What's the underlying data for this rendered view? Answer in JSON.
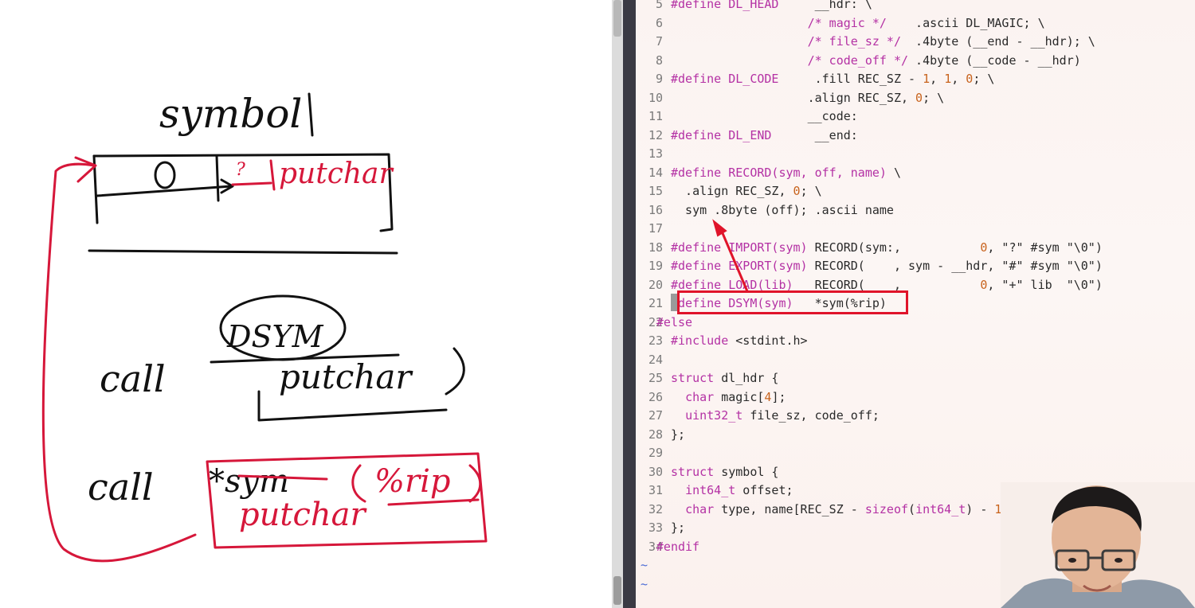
{
  "colors": {
    "macro": "#b431a4",
    "number": "#c8631d",
    "annotation_red": "#e0142a",
    "ink_red": "#d6173a",
    "ink_black": "#111111",
    "editor_bg": "#fbf3f1"
  },
  "whiteboard": {
    "label_symbol": "symbol",
    "cell_zero": "0",
    "cell_question": "?",
    "cell_putchar": "putchar",
    "call1_label": "call",
    "call1_circled": "DSYM",
    "call1_name": "putchar",
    "call2_label": "call",
    "call2_struck": "*sym",
    "call2_rip": "%rip",
    "call2_replacement": "putchar"
  },
  "editor": {
    "lines": [
      {
        "n": "5",
        "parts": [
          [
            "k-macro",
            "#define DL_HEAD"
          ],
          [
            "k-str",
            "     __hdr: \\"
          ]
        ]
      },
      {
        "n": "6",
        "parts": [
          [
            "k-str",
            "                   "
          ],
          [
            "k-macro",
            "/* magic */"
          ],
          [
            "k-str",
            "    .ascii DL_MAGIC; \\"
          ]
        ]
      },
      {
        "n": "7",
        "parts": [
          [
            "k-str",
            "                   "
          ],
          [
            "k-macro",
            "/* file_sz */"
          ],
          [
            "k-str",
            "  .4byte (__end - __hdr); \\"
          ]
        ]
      },
      {
        "n": "8",
        "parts": [
          [
            "k-str",
            "                   "
          ],
          [
            "k-macro",
            "/* code_off */"
          ],
          [
            "k-str",
            " .4byte (__code - __hdr)"
          ]
        ]
      },
      {
        "n": "9",
        "parts": [
          [
            "k-macro",
            "#define DL_CODE"
          ],
          [
            "k-str",
            "     .fill REC_SZ - "
          ],
          [
            "k-num",
            "1"
          ],
          [
            "k-str",
            ", "
          ],
          [
            "k-num",
            "1"
          ],
          [
            "k-str",
            ", "
          ],
          [
            "k-num",
            "0"
          ],
          [
            "k-str",
            "; \\"
          ]
        ]
      },
      {
        "n": "10",
        "parts": [
          [
            "k-str",
            "                   .align REC_SZ, "
          ],
          [
            "k-num",
            "0"
          ],
          [
            "k-str",
            "; \\"
          ]
        ]
      },
      {
        "n": "11",
        "parts": [
          [
            "k-str",
            "                   __code:"
          ]
        ]
      },
      {
        "n": "12",
        "parts": [
          [
            "k-macro",
            "#define DL_END"
          ],
          [
            "k-str",
            "      __end:"
          ]
        ]
      },
      {
        "n": "13",
        "parts": []
      },
      {
        "n": "14",
        "parts": [
          [
            "k-macro",
            "#define RECORD(sym, off, name)"
          ],
          [
            "k-str",
            " \\"
          ]
        ]
      },
      {
        "n": "15",
        "parts": [
          [
            "k-str",
            "  .align REC_SZ, "
          ],
          [
            "k-num",
            "0"
          ],
          [
            "k-str",
            "; \\"
          ]
        ]
      },
      {
        "n": "16",
        "parts": [
          [
            "k-str",
            "  sym .8byte (off); .ascii name"
          ]
        ]
      },
      {
        "n": "17",
        "parts": []
      },
      {
        "n": "18",
        "parts": [
          [
            "k-macro",
            "#define IMPORT(sym)"
          ],
          [
            "k-str",
            " RECORD(sym:,           "
          ],
          [
            "k-num",
            "0"
          ],
          [
            "k-str",
            ", \"?\" #sym \"\\0\")"
          ]
        ]
      },
      {
        "n": "19",
        "parts": [
          [
            "k-macro",
            "#define EXPORT(sym)"
          ],
          [
            "k-str",
            " RECORD(    , sym - __hdr, \"#\" #sym \"\\0\")"
          ]
        ]
      },
      {
        "n": "20",
        "parts": [
          [
            "k-macro",
            "#define LOAD(lib)"
          ],
          [
            "k-str",
            "   RECORD(    ,           "
          ],
          [
            "k-num",
            "0"
          ],
          [
            "k-str",
            ", \"+\" lib  \"\\0\")"
          ]
        ]
      },
      {
        "n": "21",
        "parts": [
          [
            "k-macro",
            "#define DSYM(sym)"
          ],
          [
            "k-str",
            "   *sym(%rip)"
          ]
        ]
      },
      {
        "n": "22",
        "indent": -2,
        "parts": [
          [
            "k-macro",
            "#else"
          ]
        ]
      },
      {
        "n": "23",
        "parts": [
          [
            "k-macro",
            "#include"
          ],
          [
            "k-str",
            " <stdint.h>"
          ]
        ]
      },
      {
        "n": "24",
        "parts": []
      },
      {
        "n": "25",
        "parts": [
          [
            "k-type",
            "struct"
          ],
          [
            "k-str",
            " dl_hdr {"
          ]
        ]
      },
      {
        "n": "26",
        "parts": [
          [
            "k-str",
            "  "
          ],
          [
            "k-type",
            "char"
          ],
          [
            "k-str",
            " magic["
          ],
          [
            "k-num",
            "4"
          ],
          [
            "k-str",
            "];"
          ]
        ]
      },
      {
        "n": "27",
        "parts": [
          [
            "k-str",
            "  "
          ],
          [
            "k-type",
            "uint32_t"
          ],
          [
            "k-str",
            " file_sz, code_off;"
          ]
        ]
      },
      {
        "n": "28",
        "parts": [
          [
            "k-str",
            "};"
          ]
        ]
      },
      {
        "n": "29",
        "parts": []
      },
      {
        "n": "30",
        "parts": [
          [
            "k-type",
            "struct"
          ],
          [
            "k-str",
            " symbol {"
          ]
        ]
      },
      {
        "n": "31",
        "parts": [
          [
            "k-str",
            "  "
          ],
          [
            "k-type",
            "int64_t"
          ],
          [
            "k-str",
            " offset;"
          ]
        ]
      },
      {
        "n": "32",
        "parts": [
          [
            "k-str",
            "  "
          ],
          [
            "k-type",
            "char"
          ],
          [
            "k-str",
            " type, name[REC_SZ - "
          ],
          [
            "k-type",
            "sizeof"
          ],
          [
            "k-str",
            "("
          ],
          [
            "k-type",
            "int64_t"
          ],
          [
            "k-str",
            ") - "
          ],
          [
            "k-num",
            "1"
          ],
          [
            "k-str",
            "];"
          ]
        ]
      },
      {
        "n": "33",
        "parts": [
          [
            "k-str",
            "};"
          ]
        ]
      },
      {
        "n": "34",
        "indent": -2,
        "parts": [
          [
            "k-macro",
            "#endif"
          ]
        ]
      }
    ],
    "tildes": [
      "~",
      "~"
    ]
  }
}
